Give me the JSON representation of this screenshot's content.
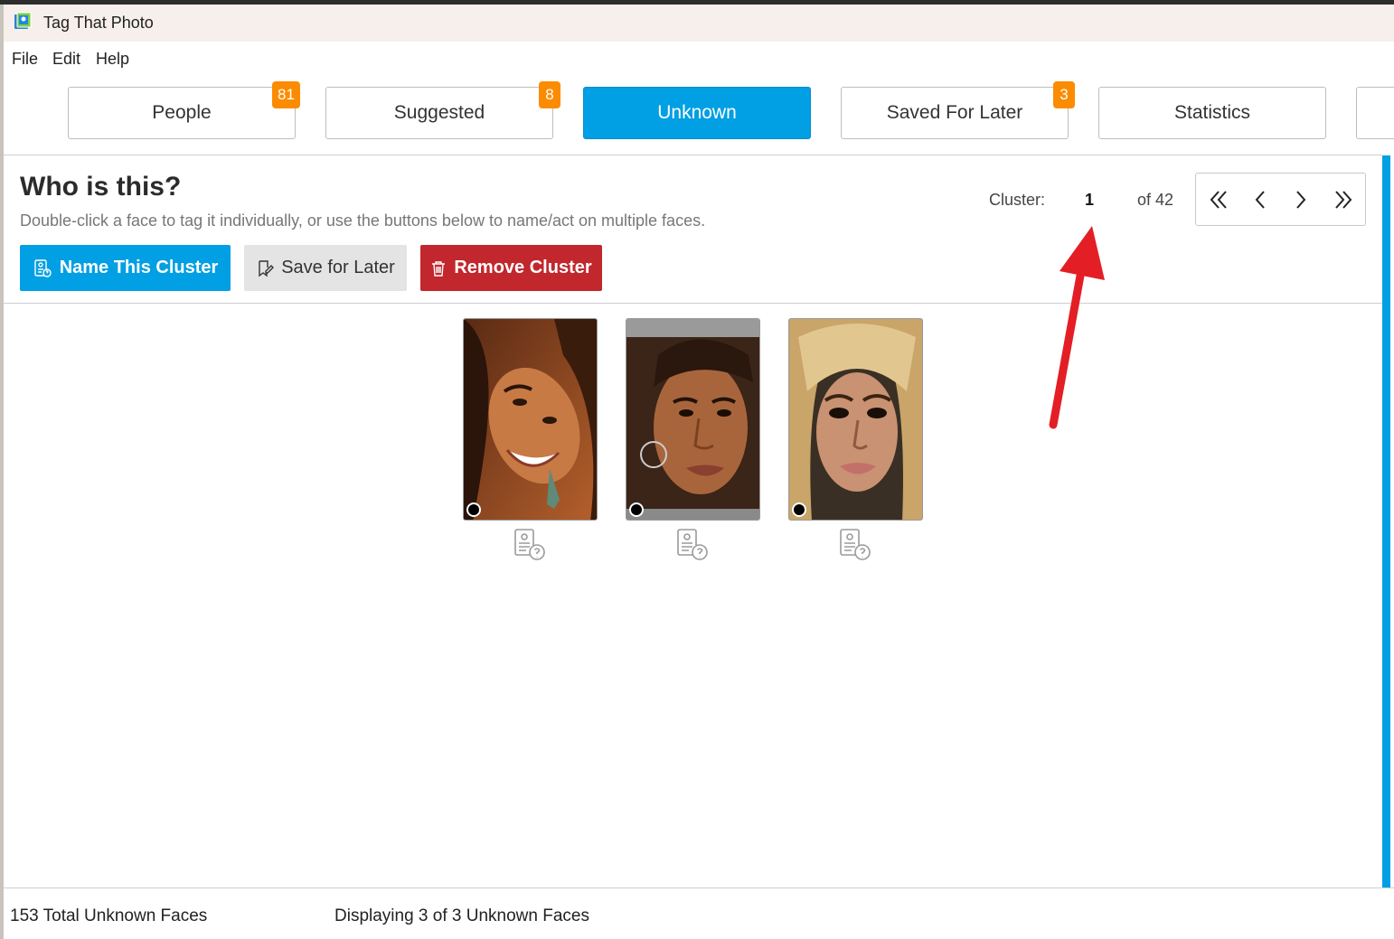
{
  "window": {
    "title": "Tag That Photo"
  },
  "menu": {
    "items": [
      "File",
      "Edit",
      "Help"
    ]
  },
  "tabs": [
    {
      "label": "People",
      "badge": "81"
    },
    {
      "label": "Suggested",
      "badge": "8"
    },
    {
      "label": "Unknown",
      "badge": null,
      "active": true
    },
    {
      "label": "Saved For Later",
      "badge": "3"
    },
    {
      "label": "Statistics",
      "badge": null
    }
  ],
  "header": {
    "title": "Who is this?",
    "subtitle": "Double-click a face to tag it individually, or use the buttons below to name/act on multiple faces."
  },
  "actions": {
    "name_cluster": "Name This Cluster",
    "save_later": "Save for Later",
    "remove_cluster": "Remove Cluster"
  },
  "cluster": {
    "label": "Cluster:",
    "current": "1",
    "total_text": "of 42"
  },
  "faces": [
    {
      "icon": "tag-person-icon"
    },
    {
      "icon": "tag-person-icon"
    },
    {
      "icon": "tag-person-icon"
    }
  ],
  "status": {
    "total": "153 Total Unknown Faces",
    "displaying": "Displaying 3 of 3 Unknown Faces"
  },
  "colors": {
    "accent": "#019fe3",
    "badge": "#fb8c00",
    "danger": "#c1272d",
    "annotation_arrow": "#e41e25"
  }
}
